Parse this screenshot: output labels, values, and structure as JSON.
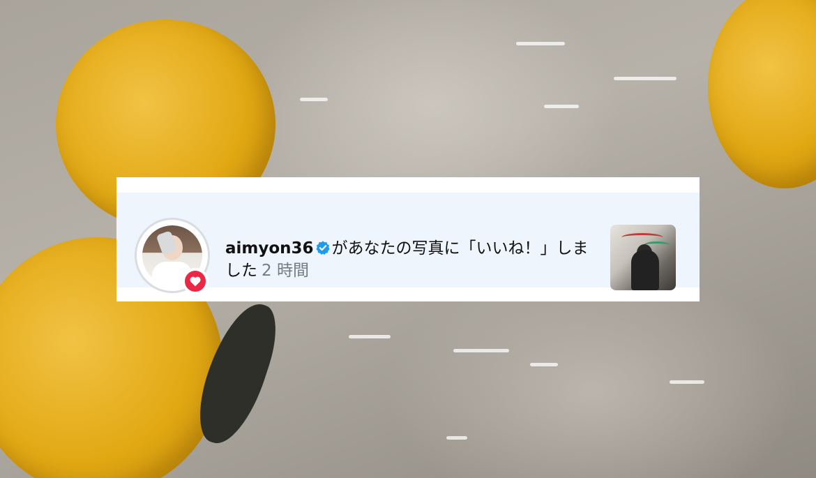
{
  "notification": {
    "username": "aimyon36",
    "action_text": "があなたの写真に「いいね！」しました",
    "time": "2 時間",
    "verified_icon": "verified-badge-icon",
    "like_icon": "heart-icon",
    "badge_color": "#ec2745",
    "verified_color": "#1d9bf0",
    "background_color": "#eef5fc"
  }
}
